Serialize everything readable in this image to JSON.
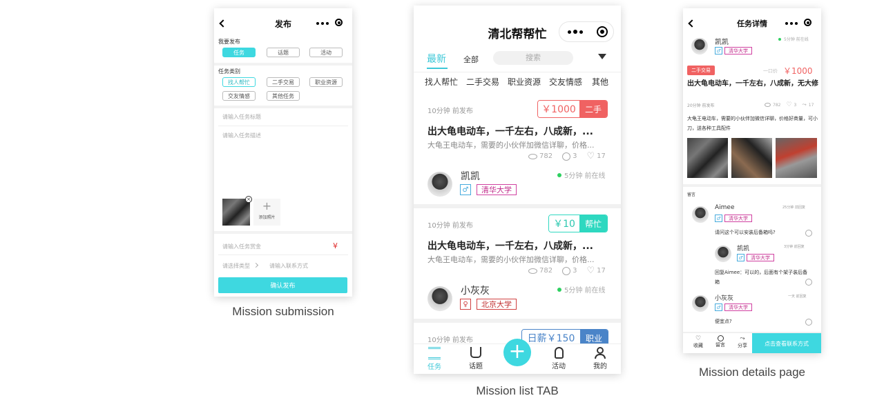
{
  "colors": {
    "accent": "#3ed8e0",
    "red": "#f06262",
    "green": "#2ed060",
    "job": "#4a84c8"
  },
  "submission": {
    "title": "发布",
    "want_label": "我要发布",
    "post_types": [
      "任务",
      "话题",
      "活动"
    ],
    "category_label": "任务类别",
    "categories": [
      "找人帮忙",
      "二手交易",
      "职业资源",
      "交友情感",
      "其他任务"
    ],
    "title_placeholder": "请输入任务标题",
    "desc_placeholder": "请输入任务描述",
    "add_photo": "添加照片",
    "reward_placeholder": "请输入任务赏金",
    "currency": "¥",
    "type_placeholder": "请选择类型",
    "contact_placeholder": "请输入联系方式",
    "submit": "确认发布",
    "caption": "Mission submission"
  },
  "list": {
    "title": "清北帮帮忙",
    "tabs": [
      "最新",
      "全部"
    ],
    "search_placeholder": "搜索",
    "categories": [
      "找人帮忙",
      "二手交易",
      "职业资源",
      "交友情感",
      "其他"
    ],
    "cards": [
      {
        "time": "10分钟 前发布",
        "price": "￥1000",
        "label": "二手",
        "title": "出大龟电动车，一千左右，八成新，...",
        "desc": "大龟王电动车，需要的小伙伴加微信详聊，价格...",
        "views": "782",
        "comments": "3",
        "likes": "17",
        "user": "凯凯",
        "school": "清华大学",
        "online": "5分钟 前在线"
      },
      {
        "time": "10分钟 前发布",
        "price": "￥10",
        "label": "帮忙",
        "title": "出大龟电动车，一千左右，八成新，...",
        "desc": "大龟王电动车，需要的小伙伴加微信详聊，价格...",
        "views": "782",
        "comments": "3",
        "likes": "17",
        "user": "小灰灰",
        "school": "北京大学",
        "online": "5分钟 前在线"
      },
      {
        "time": "10分钟 前发布",
        "price": "日薪￥150",
        "label": "职业"
      }
    ],
    "bottom_tabs": [
      "任务",
      "话题",
      "活动",
      "我的"
    ],
    "caption": "Mission list TAB"
  },
  "details": {
    "title": "任务详情",
    "user": "凯凯",
    "school": "清华大学",
    "online": "5分钟 前在线",
    "badge": "二手交易",
    "price_type": "一口价",
    "price": "￥1000",
    "item_title": "出大龟电动车，一千左右，八成新，无大修",
    "time": "20分钟 前发布",
    "views": "782",
    "comments": "3",
    "likes": "17",
    "desc": "大龟王电动车，需要的小伙伴加微信详聊，价格好商量，可小刀，送各种工具配件",
    "comments_label": "留言",
    "comments_list": [
      {
        "user": "Aimee",
        "school": "清华大学",
        "time": "25分钟 前回复",
        "text": "请问这个可以安装后备箱吗?"
      },
      {
        "user": "凯凯",
        "school": "清华大学",
        "time": "3分钟 前回复",
        "text": "回复Aimee：可以的，后面有个架子装后备箱"
      },
      {
        "user": "小灰灰",
        "school": "清华大学",
        "time": "一天 前回复",
        "text": "便宜点?"
      }
    ],
    "actions": [
      "收藏",
      "留言",
      "分享"
    ],
    "contact": "点击查看联系方式",
    "caption": "Mission details page"
  }
}
